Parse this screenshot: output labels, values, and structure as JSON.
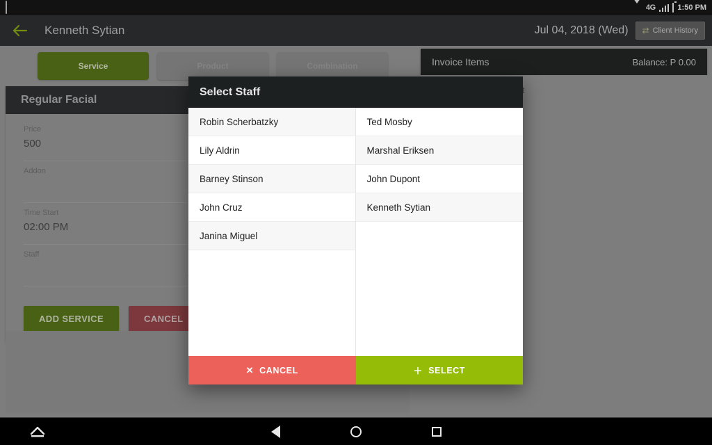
{
  "status_bar": {
    "notification_icon": "screenshot-icon",
    "wifi_icon": "wifi-icon",
    "network_label": "4G",
    "signal_icon": "signal-bars-icon",
    "battery_icon": "battery-icon",
    "clock": "1:50 PM"
  },
  "header": {
    "back_icon": "back-arrow-icon",
    "title": "Kenneth Sytian",
    "date": "Jul 04, 2018 (Wed)",
    "client_history_label": "Client History",
    "client_history_icon": "swap-icon"
  },
  "tabs": [
    {
      "label": "Service",
      "active": true
    },
    {
      "label": "Product",
      "active": false
    },
    {
      "label": "Combination",
      "active": false
    }
  ],
  "service_card": {
    "title": "Regular Facial",
    "fields": [
      {
        "label": "Price",
        "value": "500"
      },
      {
        "label": "Addon",
        "value": ""
      },
      {
        "label": "Time Start",
        "value": "02:00 PM"
      },
      {
        "label": "Staff",
        "value": "",
        "icon": "chevron-down-icon"
      }
    ],
    "add_button": "ADD SERVICE",
    "cancel_button": "CANCEL"
  },
  "invoice_panel": {
    "title": "Invoice Items",
    "balance": "Balance: P 0.00",
    "empty_text": "Select items on the left"
  },
  "modal": {
    "title": "Select Staff",
    "columns": [
      [
        "Robin Scherbatzky",
        "Lily Aldrin",
        "Barney Stinson",
        "John Cruz",
        "Janina Miguel"
      ],
      [
        "Ted Mosby",
        "Marshal Eriksen",
        "John Dupont",
        "Kenneth Sytian"
      ]
    ],
    "cancel_label": "CANCEL",
    "cancel_glyph": "✕",
    "select_label": "SELECT",
    "select_glyph": "＋"
  },
  "nav_bar": {
    "collapse_icon": "collapse-up-icon",
    "back_icon": "nav-back-icon",
    "home_icon": "nav-home-icon",
    "recents_icon": "nav-recents-icon"
  },
  "colors": {
    "accent_green": "#4e7203",
    "select_green": "#95bc07",
    "cancel_red": "#ec6159",
    "dark_red": "#99373d",
    "header_dark": "#1d2021",
    "page_gray": "#9a9a9a"
  }
}
